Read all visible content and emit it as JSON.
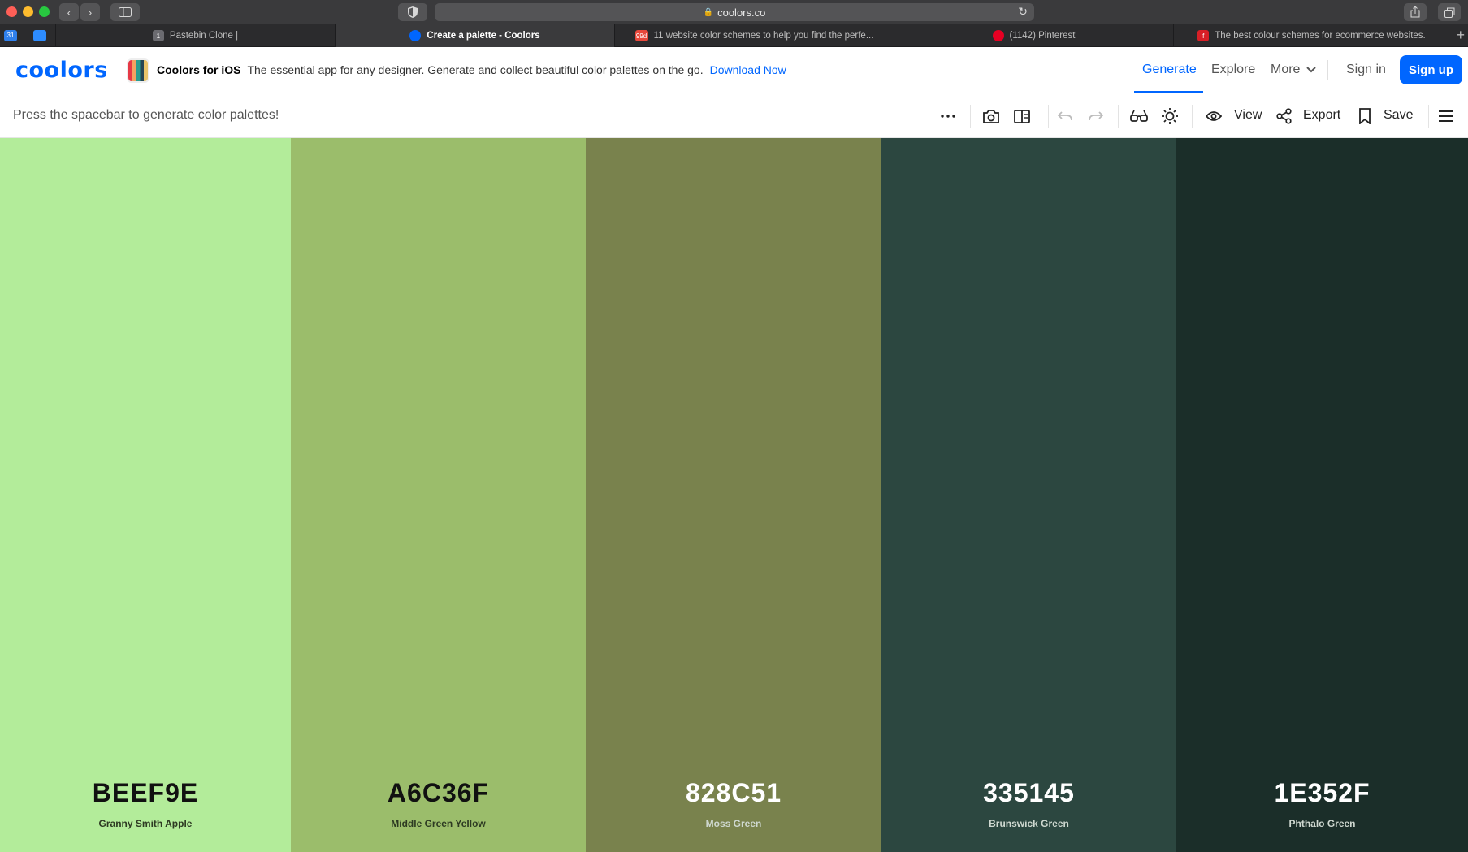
{
  "browser": {
    "url": "coolors.co",
    "tabs": [
      {
        "title": "Pastebin Clone |",
        "favicon": "1"
      },
      {
        "title": "Create a palette - Coolors",
        "favicon": ""
      },
      {
        "title": "11 website color schemes to help you find the perfe...",
        "favicon": "99d"
      },
      {
        "title": "(1142) Pinterest",
        "favicon": ""
      },
      {
        "title": "The best colour schemes for ecommerce websites.",
        "favicon": "f"
      }
    ],
    "pinned_calendar": "31"
  },
  "header": {
    "logo": "coolors",
    "promo_title": "Coolors for iOS",
    "promo_text": "The essential app for any designer. Generate and collect beautiful color palettes on the go.",
    "promo_link": "Download Now",
    "nav": {
      "generate": "Generate",
      "explore": "Explore",
      "more": "More",
      "signin": "Sign in",
      "signup": "Sign up"
    },
    "accent": "#0066ff"
  },
  "toolbar": {
    "hint": "Press the spacebar to generate color palettes!",
    "view": "View",
    "export": "Export",
    "save": "Save"
  },
  "palette": [
    {
      "hex": "BEEF9E",
      "name": "Granny Smith Apple",
      "color": "#B3EC9A"
    },
    {
      "hex": "A6C36F",
      "name": "Middle Green Yellow",
      "color": "#9BBD6B"
    },
    {
      "hex": "828C51",
      "name": "Moss Green",
      "color": "#79824D"
    },
    {
      "hex": "335145",
      "name": "Brunswick Green",
      "color": "#2C4740"
    },
    {
      "hex": "1E352F",
      "name": "Phthalo Green",
      "color": "#1B2E29"
    }
  ]
}
